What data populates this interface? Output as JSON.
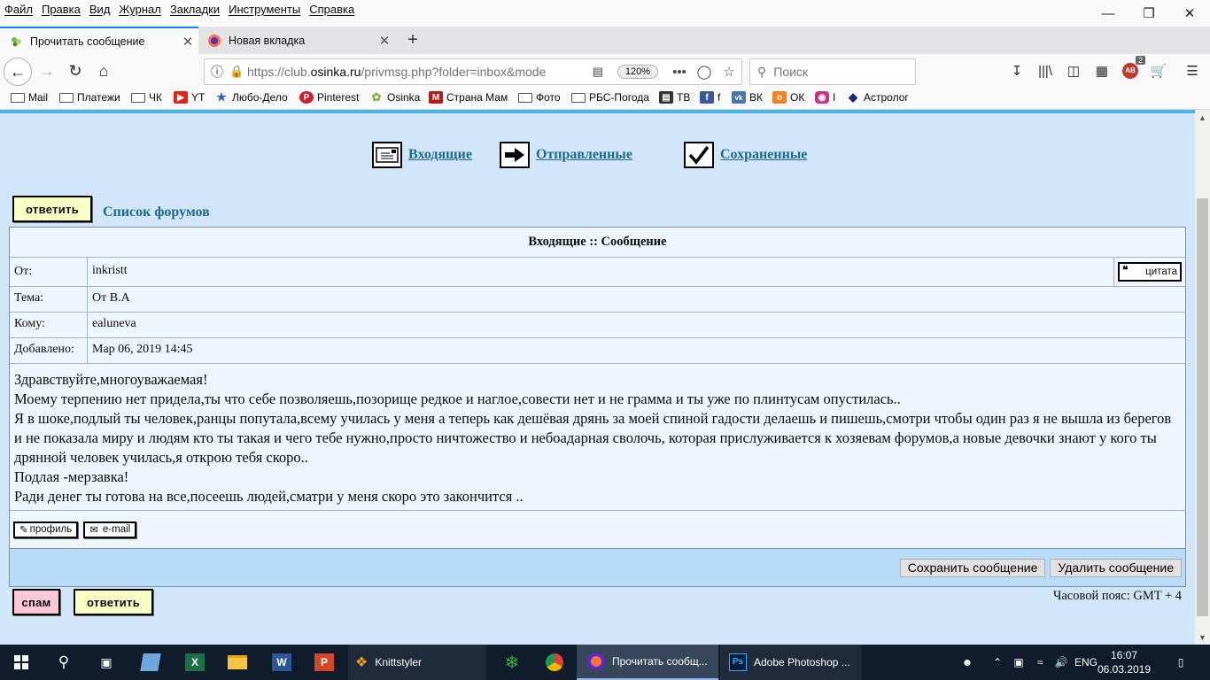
{
  "menubar": {
    "items": [
      "Файл",
      "Правка",
      "Вид",
      "Журнал",
      "Закладки",
      "Инструменты",
      "Справка"
    ]
  },
  "tabs": [
    {
      "title": "Прочитать сообщение",
      "active": true
    },
    {
      "title": "Новая вкладка",
      "active": false
    }
  ],
  "navbar": {
    "url_prefix": "https://club.",
    "url_domain": "osinka.ru",
    "url_rest": "/privmsg.php?folder=inbox&mode",
    "zoom": "120%",
    "search_placeholder": "Поиск",
    "addon_badge": "2"
  },
  "bookmarks": [
    {
      "label": "Mail",
      "icon": "folder-icon"
    },
    {
      "label": "Платежи",
      "icon": "folder-icon"
    },
    {
      "label": "ЧК",
      "icon": "folder-icon"
    },
    {
      "label": "YT",
      "icon": "youtube-icon"
    },
    {
      "label": "Любо-Дело",
      "icon": "lubodelo-icon"
    },
    {
      "label": "Pinterest",
      "icon": "pinterest-icon"
    },
    {
      "label": "Osinka",
      "icon": "osinka-icon"
    },
    {
      "label": "Страна Мам",
      "icon": "stranamam-icon"
    },
    {
      "label": "Фото",
      "icon": "folder-icon"
    },
    {
      "label": "РБС-Погода",
      "icon": "folder-icon"
    },
    {
      "label": "ТВ",
      "icon": "tv-icon"
    },
    {
      "label": "f",
      "icon": "facebook-icon"
    },
    {
      "label": "ВК",
      "icon": "vk-icon"
    },
    {
      "label": "ОК",
      "icon": "ok-icon"
    },
    {
      "label": "I",
      "icon": "instagram-icon"
    },
    {
      "label": "Астролог",
      "icon": "astrolog-icon"
    }
  ],
  "page": {
    "folders": {
      "inbox": "Входящие",
      "sent": "Отправленные",
      "saved": "Сохраненные"
    },
    "reply_label": "ответить",
    "spam_label": "спам",
    "forum_list": "Список форумов",
    "header": "Входящие :: Сообщение",
    "fields": {
      "from_label": "От:",
      "from_value": "inkristt",
      "subject_label": "Тема:",
      "subject_value": "От В.А",
      "to_label": "Кому:",
      "to_value": "ealuneva",
      "date_label": "Добавлено:",
      "date_value": "Мар 06, 2019 14:45"
    },
    "quote_label": "цитата",
    "body_lines": [
      "Здравствуйте,многоуважаемая!",
      "Моему терпению нет придела,ты что себе позволяешь,позорище редкое и наглое,совести нет и не грамма и ты уже по плинтусам опустилась..",
      "Я в шоке,подлый ты человек,ранцы попутала,всему училась у меня а теперь как дешёвая дрянь за моей спиной гадости делаешь и пишешь,смотри чтобы один раз я не вышла из берегов и не показала миру и людям кто ты такая и чего тебе нужно,просто ничтожество и небоадарная сволочь, которая прислуживается к хозяевам форумов,а новые девочки знают у кого ты дрянной человек училась,я открою тебя скоро..",
      "Подлая -мерзавка!",
      "Ради денег ты готова на все,посеешь людей,сматри у меня скоро это закончится .."
    ],
    "profile_label": "профиль",
    "email_label": "e-mail",
    "save_label": "Сохранить сообщение",
    "delete_label": "Удалить сообщение",
    "timezone": "Часовой пояс: GMT + 4"
  },
  "taskbar": {
    "knittstyler": "Knittstyler",
    "firefox_window": "Прочитать сообщ...",
    "photoshop_window": "Adobe Photoshop ...",
    "lang": "ENG",
    "time": "16:07",
    "date": "06.03.2019"
  }
}
